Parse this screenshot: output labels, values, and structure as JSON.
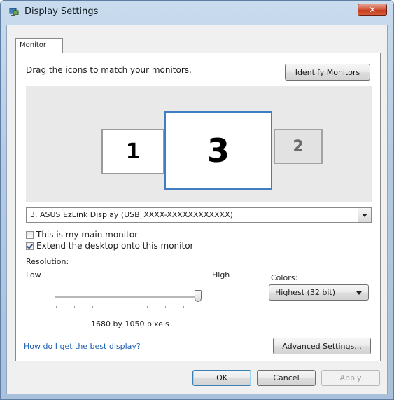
{
  "window": {
    "title": "Display Settings",
    "close_glyph": "✕",
    "icon": "display-settings-icon"
  },
  "tabs": [
    {
      "label": "Monitor",
      "selected": true
    }
  ],
  "monitor_tab": {
    "instruction": "Drag the icons to match your monitors.",
    "identify_button": "Identify Monitors",
    "monitors": [
      {
        "number": "1",
        "selected": false,
        "active": true
      },
      {
        "number": "3",
        "selected": true,
        "active": true
      },
      {
        "number": "2",
        "selected": false,
        "active": false
      }
    ],
    "display_select": {
      "value": "3. ASUS EzLink Display (USB_XXXX-XXXXXXXXXXXX)"
    },
    "main_monitor": {
      "label": "This is my main monitor",
      "checked": false
    },
    "extend_desktop": {
      "label": "Extend the desktop onto this monitor",
      "checked": true
    },
    "resolution": {
      "label": "Resolution:",
      "low": "Low",
      "high": "High",
      "value_text": "1680 by 1050 pixels",
      "slider_position": 1.0
    },
    "colors": {
      "label": "Colors:",
      "value": "Highest (32 bit)"
    },
    "help_link": "How do I get the best display?",
    "advanced_button": "Advanced Settings..."
  },
  "footer": {
    "ok": "OK",
    "cancel": "Cancel",
    "apply": "Apply"
  },
  "colors_theme": {
    "selected_monitor_border": "#3f7ec2",
    "link": "#1c5fb0",
    "close_button": "#c53a1d"
  }
}
